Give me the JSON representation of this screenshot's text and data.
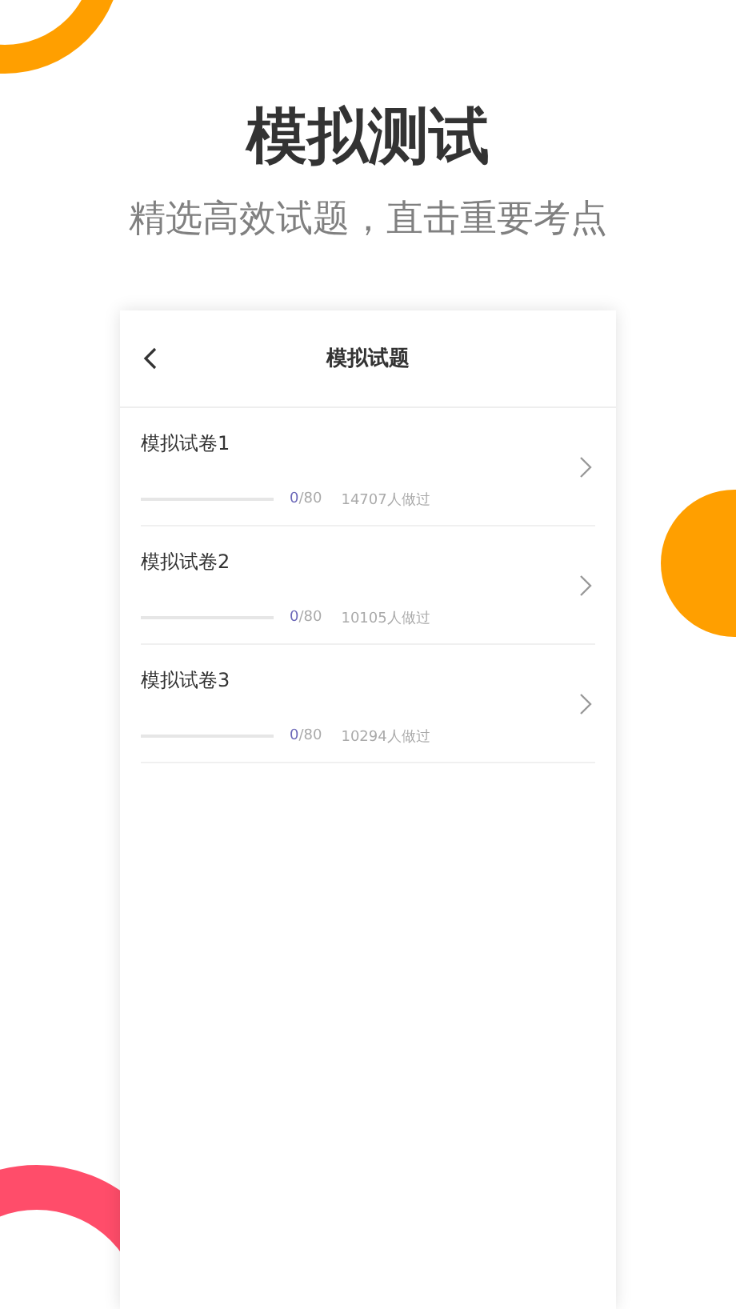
{
  "headline": "模拟测试",
  "subtitle": "精选高效试题，直击重要考点",
  "screen": {
    "title": "模拟试题",
    "papers": [
      {
        "name": "模拟试卷1",
        "level": 0,
        "done": "0",
        "total": "/80",
        "takers": "14707人做过"
      },
      {
        "name": "模拟试卷2",
        "level": 0,
        "done": "0",
        "total": "/80",
        "takers": "10105人做过"
      },
      {
        "name": "模拟试卷3",
        "level": 0,
        "done": "0",
        "total": "/80",
        "takers": "10294人做过"
      }
    ]
  }
}
